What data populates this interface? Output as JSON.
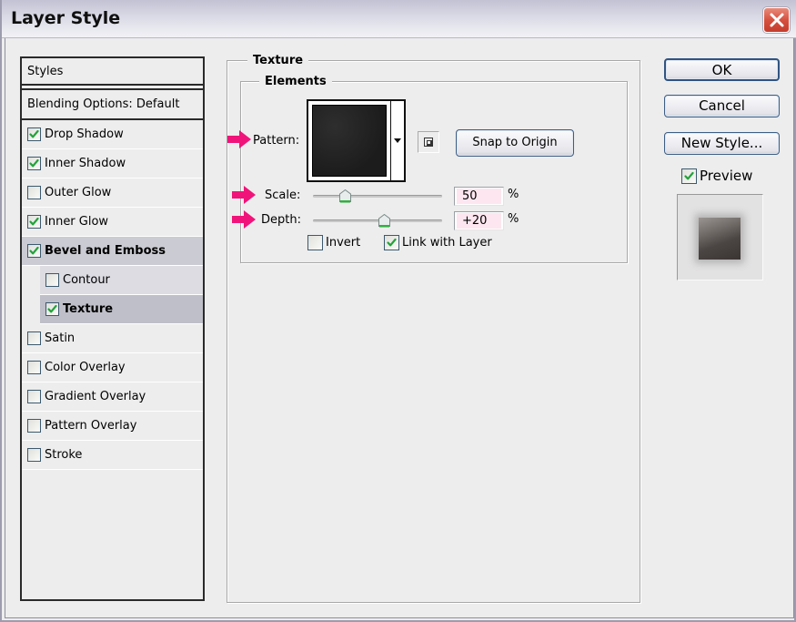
{
  "window": {
    "title": "Layer Style",
    "close_icon": "close-icon"
  },
  "styles_panel": {
    "header": "Styles",
    "blending_options": "Blending Options: Default",
    "items": [
      {
        "label": "Drop Shadow",
        "checked": true,
        "selected": false,
        "sub": false
      },
      {
        "label": "Inner Shadow",
        "checked": true,
        "selected": false,
        "sub": false
      },
      {
        "label": "Outer Glow",
        "checked": false,
        "selected": false,
        "sub": false
      },
      {
        "label": "Inner Glow",
        "checked": true,
        "selected": false,
        "sub": false
      },
      {
        "label": "Bevel and Emboss",
        "checked": true,
        "selected": true,
        "sub": false
      },
      {
        "label": "Contour",
        "checked": false,
        "selected": false,
        "sub": true
      },
      {
        "label": "Texture",
        "checked": true,
        "selected": true,
        "sub": true
      },
      {
        "label": "Satin",
        "checked": false,
        "selected": false,
        "sub": false
      },
      {
        "label": "Color Overlay",
        "checked": false,
        "selected": false,
        "sub": false
      },
      {
        "label": "Gradient Overlay",
        "checked": false,
        "selected": false,
        "sub": false
      },
      {
        "label": "Pattern Overlay",
        "checked": false,
        "selected": false,
        "sub": false
      },
      {
        "label": "Stroke",
        "checked": false,
        "selected": false,
        "sub": false
      }
    ]
  },
  "texture": {
    "group_title": "Texture",
    "elements_title": "Elements",
    "pattern_label": "Pattern:",
    "snap_button": "Snap to Origin",
    "scale_label": "Scale:",
    "scale_value": "50",
    "scale_unit": "%",
    "scale_slider_fraction": 0.25,
    "depth_label": "Depth:",
    "depth_value": "+20",
    "depth_unit": "%",
    "depth_slider_fraction": 0.55,
    "invert_label": "Invert",
    "invert_checked": false,
    "link_label": "Link with Layer",
    "link_checked": true
  },
  "annotations": {
    "arrow_color": "#f0147a"
  },
  "actions": {
    "ok": "OK",
    "cancel": "Cancel",
    "new_style": "New Style...",
    "preview_label": "Preview",
    "preview_checked": true
  }
}
